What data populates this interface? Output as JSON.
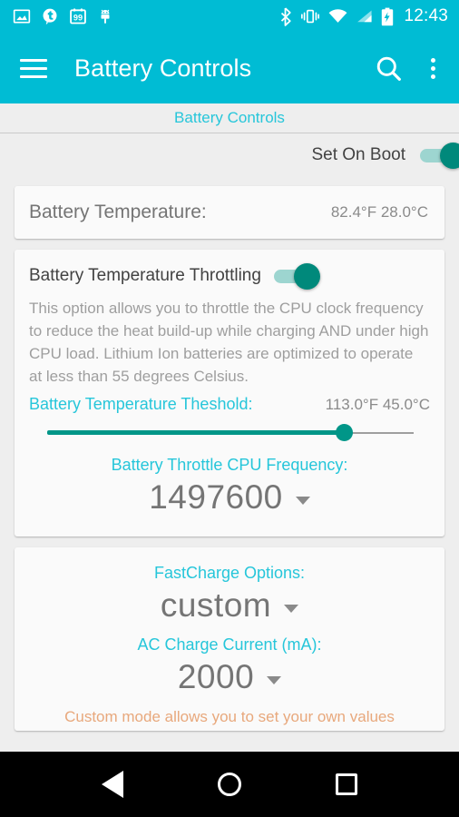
{
  "status_bar": {
    "clock": "12:43",
    "left_icons": [
      {
        "name": "image-icon",
        "glyph": "photo"
      },
      {
        "name": "tumblr-notification-icon",
        "glyph": "t"
      },
      {
        "name": "calendar-99-icon",
        "glyph": "99"
      },
      {
        "name": "android-robot-icon",
        "glyph": "android"
      }
    ],
    "right_icons": [
      {
        "name": "bluetooth-icon"
      },
      {
        "name": "vibrate-icon"
      },
      {
        "name": "wifi-icon"
      },
      {
        "name": "cell-signal-icon"
      },
      {
        "name": "battery-charging-icon"
      }
    ]
  },
  "toolbar": {
    "title": "Battery Controls",
    "menu_icon": "hamburger-icon",
    "search_icon": "search-icon",
    "overflow_icon": "overflow-menu-icon"
  },
  "section": {
    "header": "Battery Controls",
    "set_on_boot_label": "Set On Boot",
    "set_on_boot_enabled": true
  },
  "battery_temperature": {
    "label": "Battery Temperature:",
    "value": "82.4°F 28.0°C"
  },
  "throttling": {
    "title": "Battery Temperature Throttling",
    "enabled": true,
    "description": "This option allows you to throttle the CPU clock frequency to reduce the heat build-up while charging AND under high CPU load. Lithium Ion batteries are optimized to operate at less than 55 degrees Celsius.",
    "threshold_label": "Battery Temperature Theshold:",
    "threshold_value": "113.0°F 45.0°C",
    "threshold_slider_percent": 81,
    "cpu_frequency_label": "Battery Throttle CPU Frequency:",
    "cpu_frequency_value": "1497600"
  },
  "fastcharge": {
    "options_label": "FastCharge Options:",
    "options_value": "custom",
    "ac_current_label": "AC Charge Current (mA):",
    "ac_current_value": "2000",
    "hint_text": "Custom mode allows you to set your own values"
  },
  "nav_bar": {
    "back": "back-button",
    "home": "home-button",
    "recents": "recents-button"
  },
  "colors": {
    "accent": "#00BCD4",
    "teal_text": "#26C6DA",
    "toggle_on": "#00897B",
    "slider": "#009688",
    "background": "#EEEEEE",
    "card": "#FAFAFA"
  }
}
